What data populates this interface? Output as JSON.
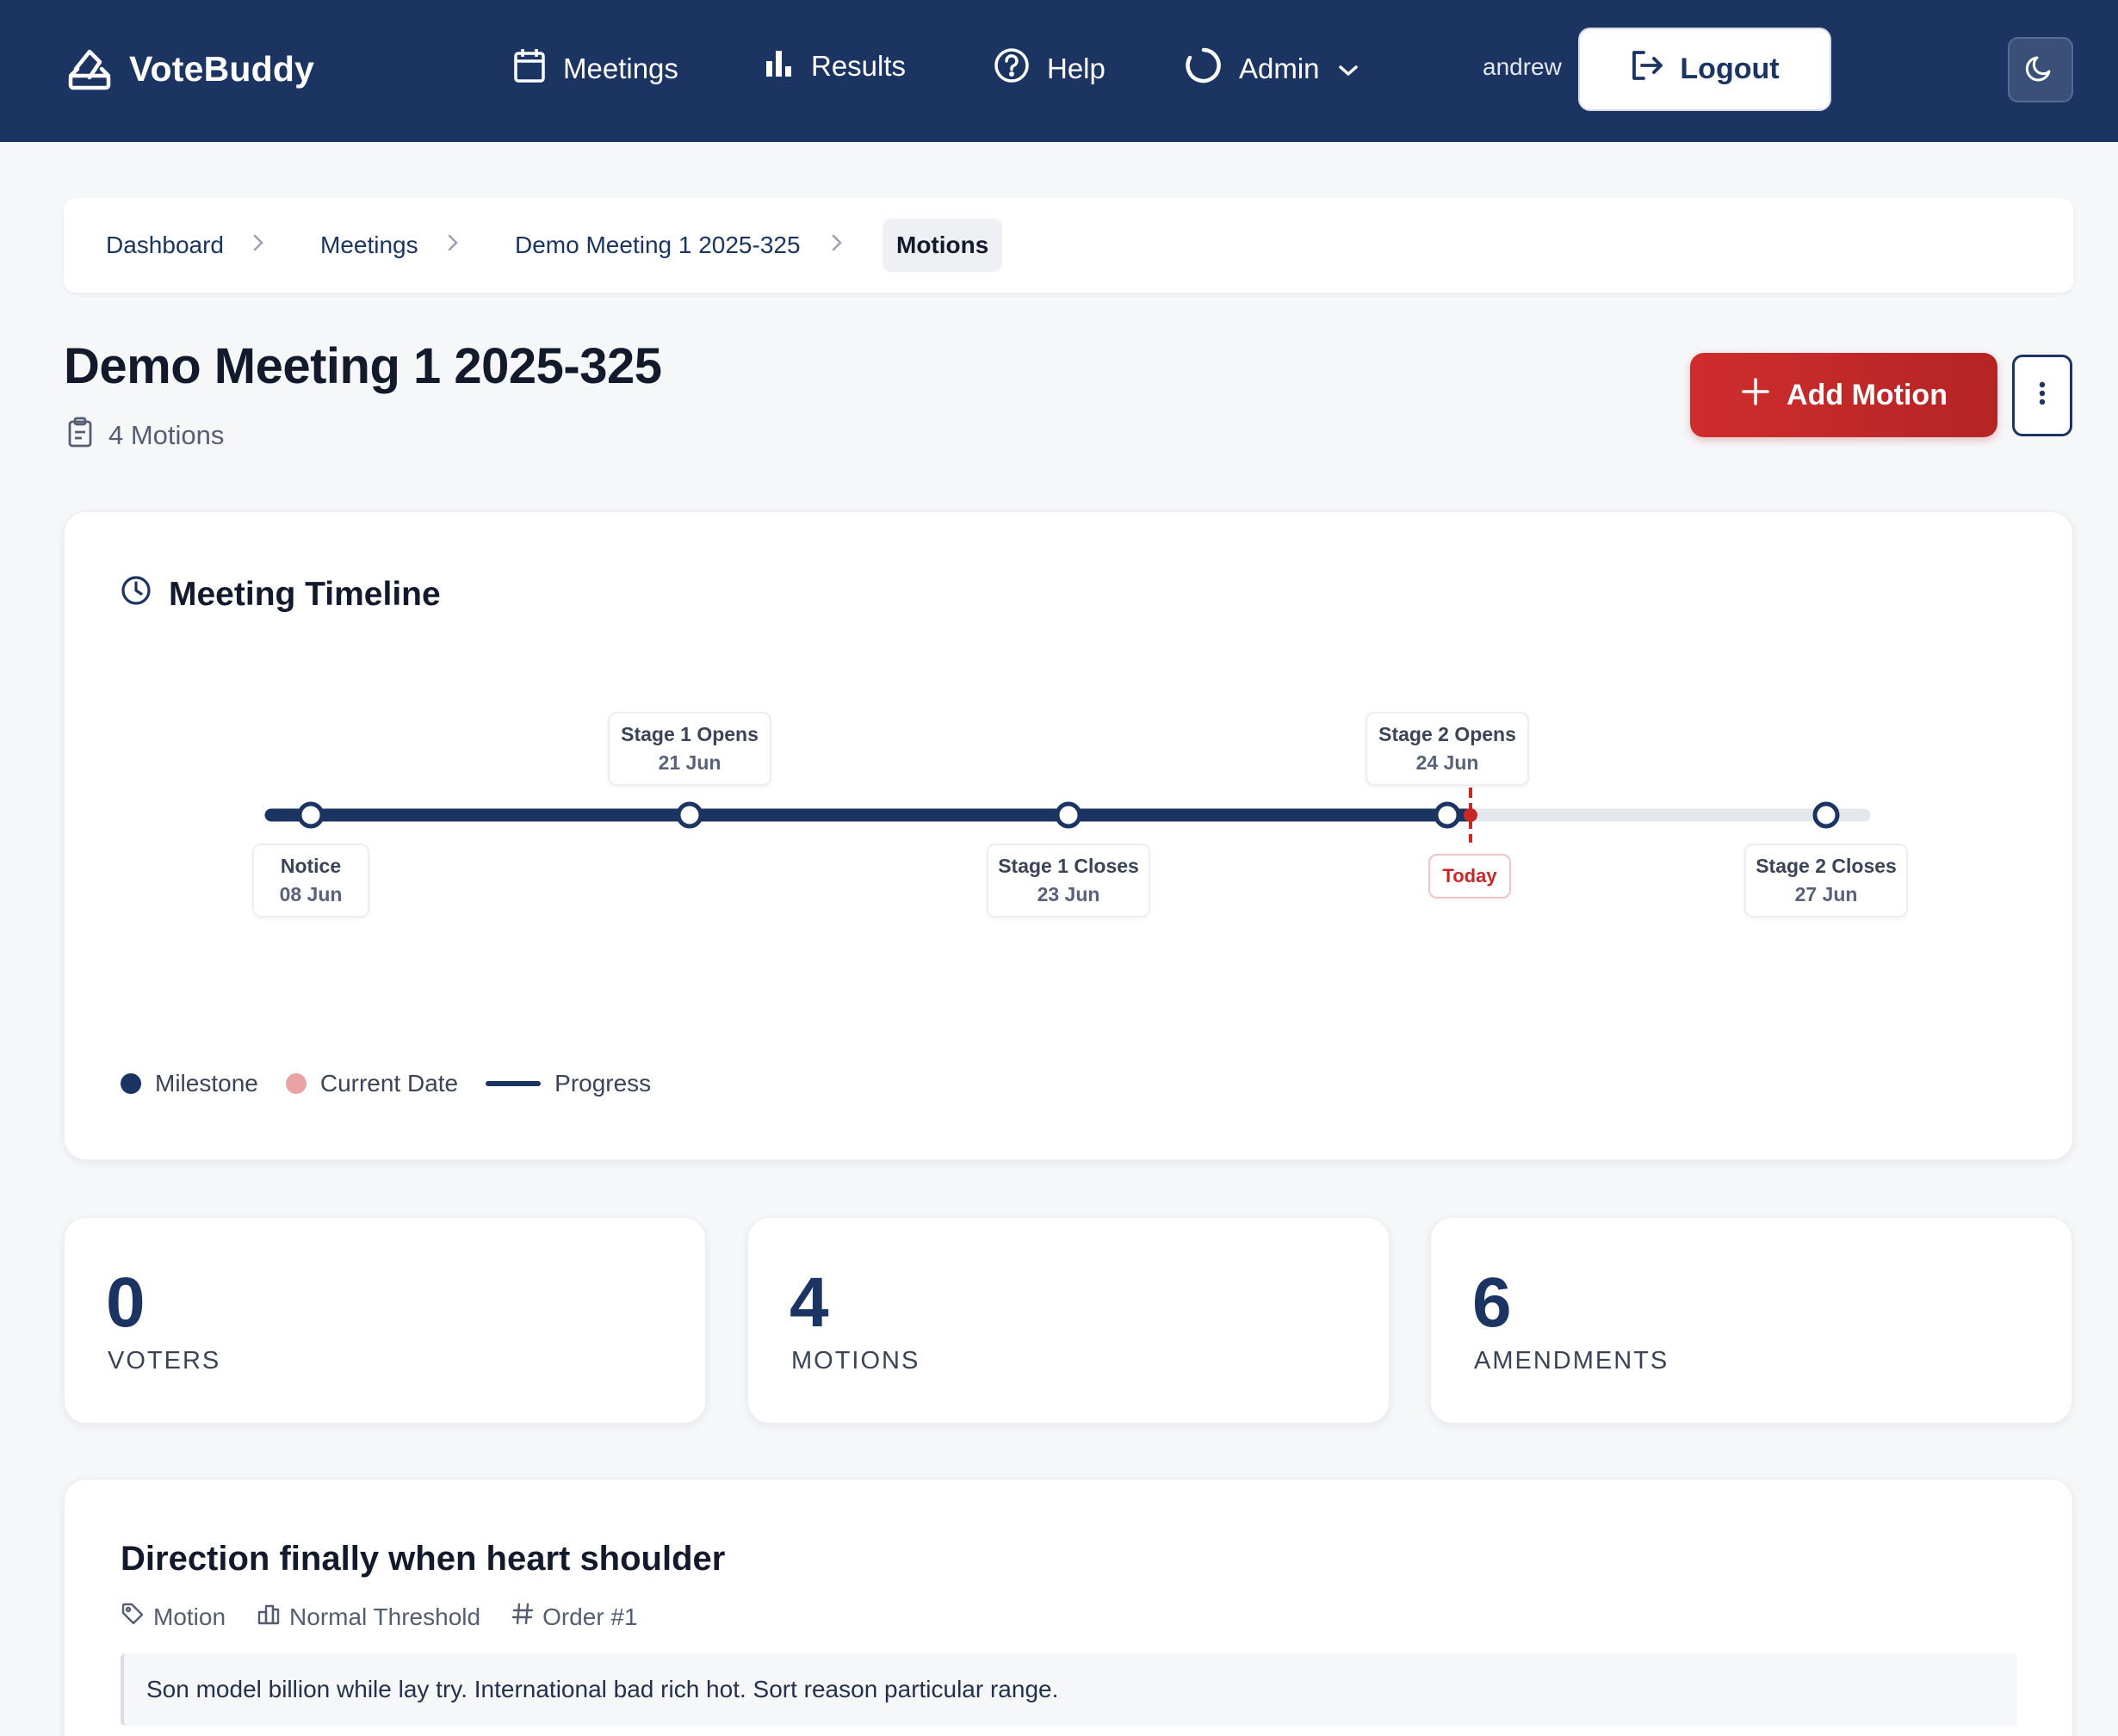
{
  "brand": {
    "name": "VoteBuddy"
  },
  "nav": {
    "meetings": "Meetings",
    "results": "Results",
    "help": "Help",
    "admin": "Admin"
  },
  "user": {
    "name": "andrew",
    "logout_label": "Logout"
  },
  "breadcrumb": {
    "items": [
      "Dashboard",
      "Meetings",
      "Demo Meeting 1 2025-325"
    ],
    "current": "Motions"
  },
  "page": {
    "title": "Demo Meeting 1 2025-325",
    "motion_count": "4 Motions",
    "add_motion_label": "Add Motion"
  },
  "timeline": {
    "title": "Meeting Timeline",
    "milestones": [
      {
        "name": "Notice",
        "date": "08 Jun"
      },
      {
        "name": "Stage 1 Opens",
        "date": "21 Jun"
      },
      {
        "name": "Stage 1 Closes",
        "date": "23 Jun"
      },
      {
        "name": "Stage 2 Opens",
        "date": "24 Jun"
      },
      {
        "name": "Stage 2 Closes",
        "date": "27 Jun"
      }
    ],
    "today_label": "Today",
    "legend": {
      "milestone": "Milestone",
      "current_date": "Current Date",
      "progress": "Progress"
    },
    "colors": {
      "progress": "#1b3461",
      "today": "#c62828",
      "current_date_dot": "#eaa3a3",
      "track": "#e4e7ec"
    }
  },
  "stats": [
    {
      "value": "0",
      "label": "VOTERS"
    },
    {
      "value": "4",
      "label": "MOTIONS"
    },
    {
      "value": "6",
      "label": "AMENDMENTS"
    }
  ],
  "motions": [
    {
      "title": "Direction finally when heart shoulder",
      "type": "Motion",
      "threshold": "Normal Threshold",
      "order": "Order #1",
      "description": "Son model billion while lay try. International bad rich hot. Sort reason particular range."
    }
  ]
}
